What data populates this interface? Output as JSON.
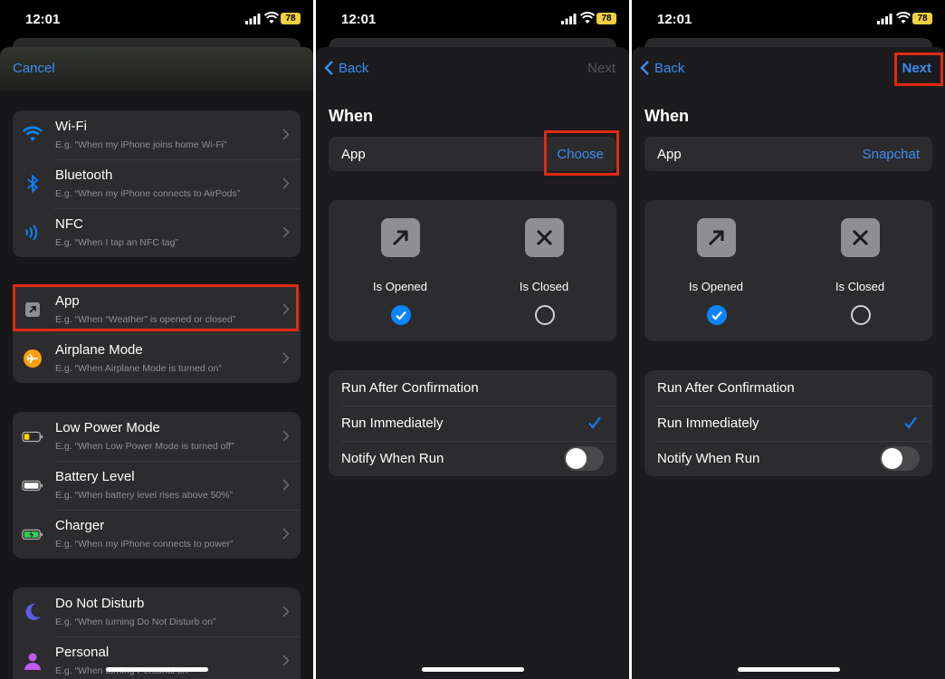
{
  "status": {
    "time": "12:01",
    "battery": "78"
  },
  "panel1": {
    "cancel": "Cancel",
    "groups": [
      [
        {
          "title": "Wi-Fi",
          "subtitle": "E.g. “When my iPhone joins home Wi-Fi”",
          "icon": "wifi-icon"
        },
        {
          "title": "Bluetooth",
          "subtitle": "E.g. “When my iPhone connects to AirPods”",
          "icon": "bluetooth-icon"
        },
        {
          "title": "NFC",
          "subtitle": "E.g. “When I tap an NFC tag”",
          "icon": "nfc-icon"
        }
      ],
      [
        {
          "title": "App",
          "subtitle": "E.g. “When “Weather” is opened or closed”",
          "icon": "app-arrow-icon"
        },
        {
          "title": "Airplane Mode",
          "subtitle": "E.g. “When Airplane Mode is turned on”",
          "icon": "airplane-icon"
        }
      ],
      [
        {
          "title": "Low Power Mode",
          "subtitle": "E.g. “When Low Power Mode is turned off”",
          "icon": "low-battery-icon"
        },
        {
          "title": "Battery Level",
          "subtitle": "E.g. “When battery level rises above 50%”",
          "icon": "battery-icon"
        },
        {
          "title": "Charger",
          "subtitle": "E.g. “When my iPhone connects to power”",
          "icon": "charging-icon"
        }
      ],
      [
        {
          "title": "Do Not Disturb",
          "subtitle": "E.g. “When turning Do Not Disturb on”",
          "icon": "moon-icon"
        },
        {
          "title": "Personal",
          "subtitle": "E.g. “When turning Personal on”",
          "icon": "person-icon"
        }
      ]
    ]
  },
  "panel2": {
    "back": "Back",
    "next": "Next",
    "heading": "When",
    "app_label": "App",
    "app_value": "Choose",
    "is_opened": "Is Opened",
    "is_closed": "Is Closed",
    "run_after": "Run After Confirmation",
    "run_immediately": "Run Immediately",
    "notify": "Notify When Run"
  },
  "panel3": {
    "back": "Back",
    "next": "Next",
    "heading": "When",
    "app_label": "App",
    "app_value": "Snapchat",
    "is_opened": "Is Opened",
    "is_closed": "Is Closed",
    "run_after": "Run After Confirmation",
    "run_immediately": "Run Immediately",
    "notify": "Notify When Run"
  },
  "colors": {
    "accent": "#0a84ff",
    "highlight": "#e02a13",
    "background": "#1c1c1e",
    "cell": "#2c2c2e"
  }
}
